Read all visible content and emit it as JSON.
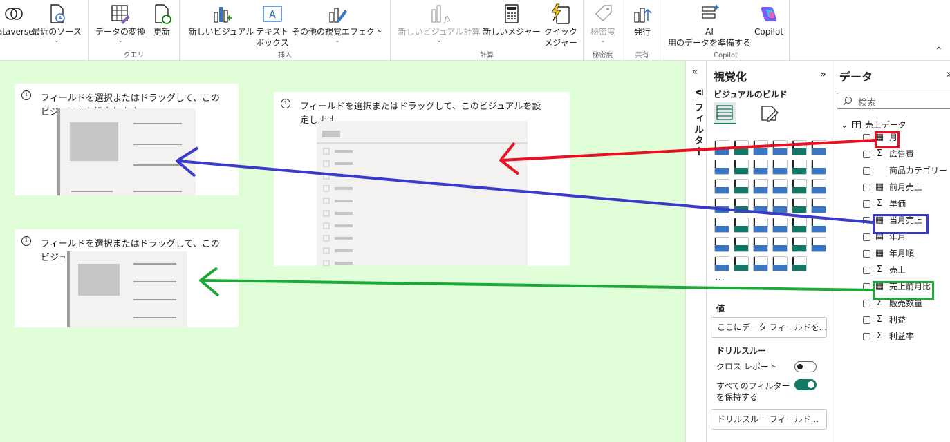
{
  "ribbon": {
    "buttons": {
      "dataverse": "ataverse",
      "recent": "最近のソース",
      "transform": "データの変換",
      "refresh": "更新",
      "new_visual": "新しいビジュアル",
      "textbox_1": "テキスト",
      "textbox_2": "ボックス",
      "more_visuals": "その他の視覚エフェクト",
      "new_visual_calc": "新しいビジュアル計算",
      "new_measure": "新しいメジャー",
      "quick_measure_1": "クイック",
      "quick_measure_2": "メジャー",
      "sensitivity": "秘密度",
      "publish": "発行",
      "ai_1": "AI",
      "ai_2": "用のデータを準備する",
      "copilot": "Copilot",
      "chevron": "⌄"
    },
    "groups": {
      "query": "クエリ",
      "insert": "挿入",
      "calc": "計算",
      "sensitivity": "秘密度",
      "share": "共有",
      "copilot": "Copilot"
    },
    "collapse": "⌃"
  },
  "canvas": {
    "background": "#e0ffd9",
    "visuals": [
      {
        "line1": "フィールドを選択またはドラッグして、この",
        "line2": "ビジュアルを設定します"
      },
      {
        "line1": "フィールドを選択またはドラッグして、このビジュアルを設",
        "line2": "定します"
      },
      {
        "line1": "フィールドを選択またはドラッグして、この",
        "line2": "ビジュ"
      }
    ],
    "info_glyph": "i"
  },
  "filters": {
    "label": "フィルター",
    "collapse": "«",
    "icon": "⊽"
  },
  "visualizations": {
    "title": "視覚化",
    "expand": "»",
    "build_label": "ビジュアルのビルド",
    "more": "…",
    "values_label": "値",
    "values_placeholder": "ここにデータ フィールドを...",
    "drillthrough_label": "ドリルスルー",
    "cross_report": "クロス レポート",
    "keep_filters_1": "すべてのフィルター",
    "keep_filters_2": "を保持する",
    "drill_placeholder": "ドリルスルー フィールド...",
    "cross_report_on": false,
    "keep_filters_on": true
  },
  "data_pane": {
    "title": "データ",
    "expand": "»",
    "search_placeholder": "検索",
    "table_expand": "⌄",
    "table_name": "売上データ",
    "fields": [
      {
        "name": "月",
        "icon": "calc"
      },
      {
        "name": "広告費",
        "icon": "sigma"
      },
      {
        "name": "商品カテゴリー",
        "icon": "none"
      },
      {
        "name": "前月売上",
        "icon": "calc"
      },
      {
        "name": "単価",
        "icon": "sigma"
      },
      {
        "name": "当月売上",
        "icon": "calc"
      },
      {
        "name": "年月",
        "icon": "calendar"
      },
      {
        "name": "年月順",
        "icon": "calc"
      },
      {
        "name": "売上",
        "icon": "sigma"
      },
      {
        "name": "売上前月比",
        "icon": "calc"
      },
      {
        "name": "販売数量",
        "icon": "sigma"
      },
      {
        "name": "利益",
        "icon": "sigma"
      },
      {
        "name": "利益率",
        "icon": "sigma"
      }
    ],
    "field_icons": {
      "calc": "▦",
      "sigma": "Σ",
      "calendar": "▤",
      "none": ""
    }
  },
  "annotations": {
    "colors": {
      "red": "#e81123",
      "blue": "#3a3ac8",
      "green": "#1fa83a"
    }
  },
  "colors": {
    "accent": "#117865",
    "pbi_yellow": "#f2c811"
  }
}
